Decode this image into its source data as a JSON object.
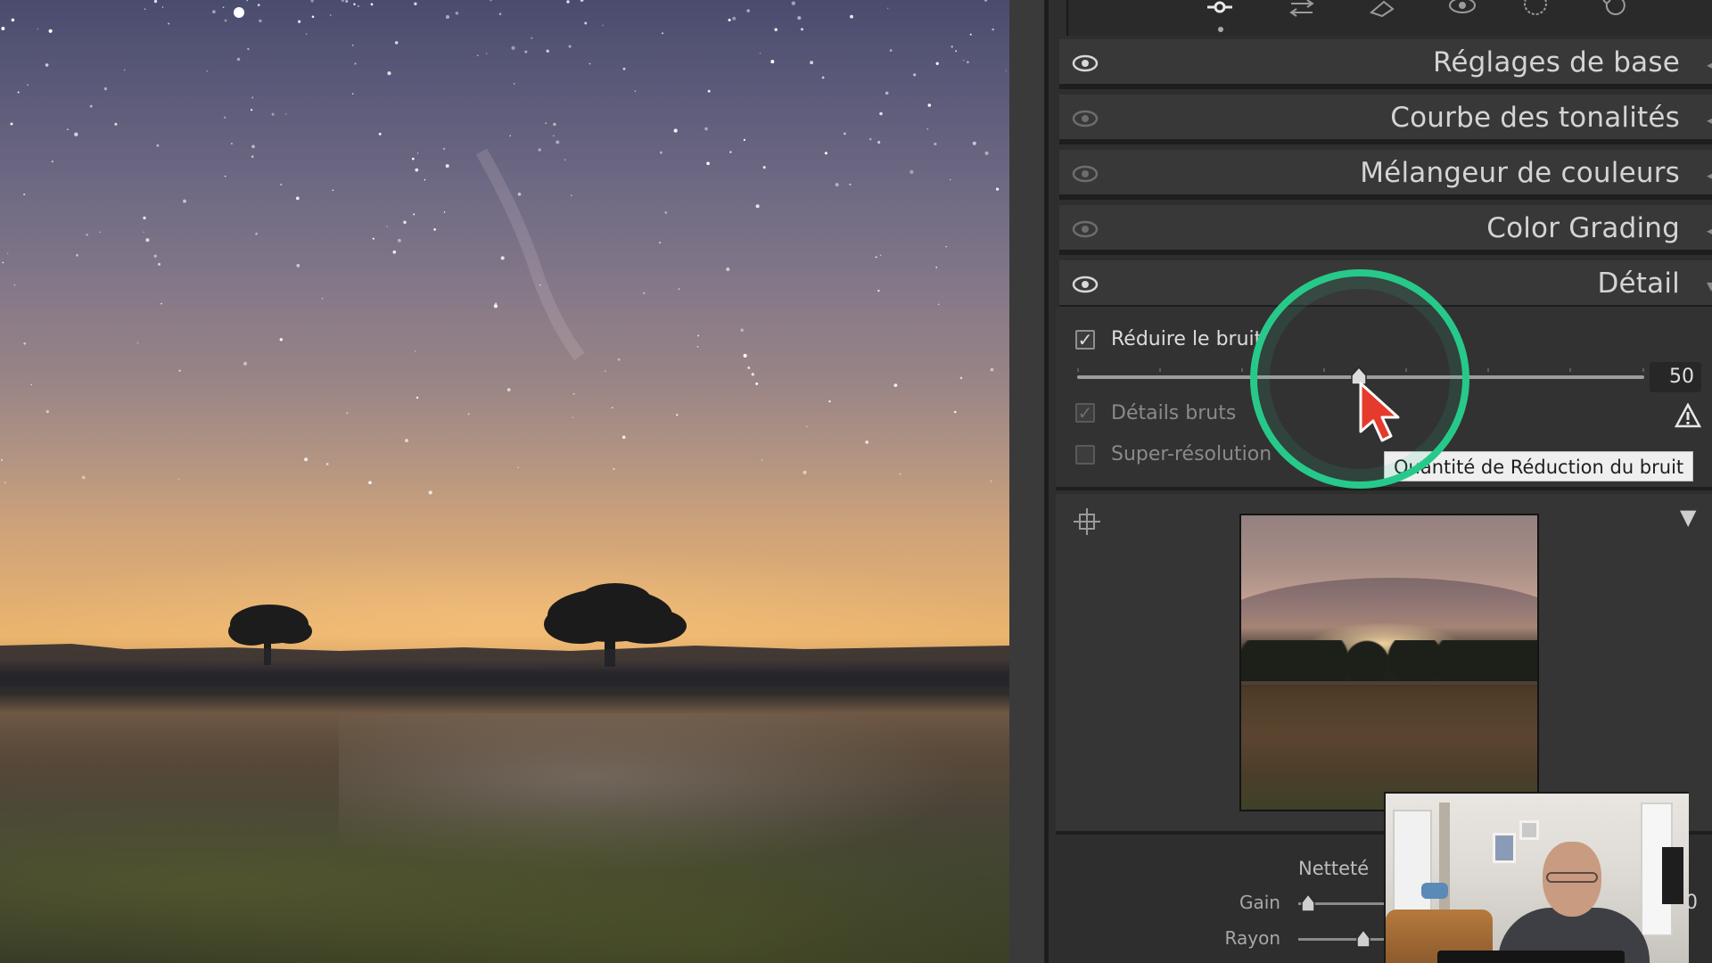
{
  "toolbar": {
    "icons": [
      "edit-sliders-icon",
      "transform-icon",
      "healing-icon",
      "redeye-icon",
      "masking-icon",
      "history-icon"
    ],
    "active": "edit-sliders-icon"
  },
  "sections": [
    {
      "title": "Réglages de base",
      "visible": true
    },
    {
      "title": "Courbe des tonalités",
      "visible": true
    },
    {
      "title": "Mélangeur de couleurs",
      "visible": true
    },
    {
      "title": "Color Grading",
      "visible": true
    },
    {
      "title": "Détail",
      "visible": true,
      "expanded": true
    }
  ],
  "detail": {
    "reduce_noise": {
      "label": "Réduire le bruit",
      "checked": true,
      "value": "50",
      "slider_fraction": 0.5
    },
    "raw_details": {
      "label": "Détails bruts",
      "checked": true,
      "enabled": false
    },
    "super_resolution": {
      "label": "Super-résolution",
      "checked": false,
      "enabled": false
    },
    "tooltip": "Quantité de Réduction du bruit"
  },
  "sharpening": {
    "title": "Netteté",
    "gain_label": "Gain",
    "radius_label": "Rayon",
    "partial_value": "0"
  },
  "colors": {
    "highlight_ring": "#27c98a",
    "cursor": "#e53b2c",
    "panel_bg": "#2e2e2e"
  }
}
